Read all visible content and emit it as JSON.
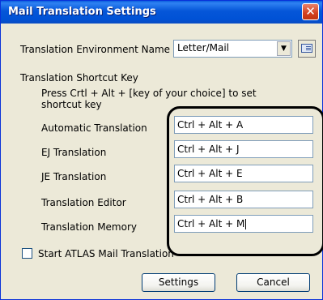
{
  "window": {
    "title": "Mail Translation Settings",
    "close_glyph": "✕"
  },
  "environment": {
    "label": "Translation Environment Name",
    "value": "Letter/Mail",
    "arrow": "▼",
    "icon": "options-icon"
  },
  "shortcut": {
    "section_label": "Translation Shortcut Key",
    "hint_line1": "Press Crtl + Alt + [key of your choice] to set",
    "hint_line2": "shortcut key",
    "rows": [
      {
        "label": "Automatic Translation",
        "value": "Ctrl + Alt + A"
      },
      {
        "label": "EJ Translation",
        "value": "Ctrl + Alt + J"
      },
      {
        "label": "JE Translation",
        "value": "Ctrl + Alt + E"
      },
      {
        "label": "Translation Editor",
        "value": "Ctrl + Alt + B"
      },
      {
        "label": "Translation Memory",
        "value": "Ctrl + Alt + M"
      }
    ]
  },
  "start_option": {
    "label": "Start ATLAS Mail Translation",
    "checked": false
  },
  "buttons": {
    "settings": "Settings",
    "cancel": "Cancel"
  },
  "colors": {
    "title_bar": "#0052d6",
    "close": "#d4401f",
    "dialog_bg": "#ece9d8",
    "highlight": "#000000"
  }
}
